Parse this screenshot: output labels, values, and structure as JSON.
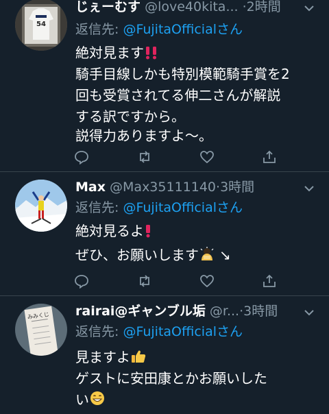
{
  "tweets": [
    {
      "name": "じぇーむす",
      "handle": "@love40kita...",
      "time": "2時間",
      "reply_prefix": "返信先: ",
      "reply_to": "@FujitaOfficialさん",
      "lines": [
        "絶対見ます",
        "騎手目線しかも特別模範騎手賞を2",
        "回も受賞されてる伸二さんが解説",
        "する訳ですから。",
        "説得力ありますよ〜。"
      ]
    },
    {
      "name": "Max",
      "handle": "@Max35111140",
      "time": "3時間",
      "reply_prefix": "返信先: ",
      "reply_to": "@FujitaOfficialさん",
      "lines": [
        "絶対見るよ",
        "ぜひ、お願いします"
      ]
    },
    {
      "name": "rairai@ギャンブル垢",
      "handle": "@r...",
      "time": "3時間",
      "reply_prefix": "返信先: ",
      "reply_to": "@FujitaOfficialさん",
      "lines": [
        "見ますよ",
        "ゲストに安田康とかお願いした",
        "い"
      ]
    }
  ],
  "avatar3_text": "みみくじ",
  "icons": [
    "reply-icon",
    "retweet-icon",
    "like-icon",
    "share-icon",
    "chevron-down-icon"
  ],
  "colors": {
    "background": "#15202b",
    "muted": "#8899a6",
    "link": "#1da1f2",
    "divider": "#38444d"
  }
}
